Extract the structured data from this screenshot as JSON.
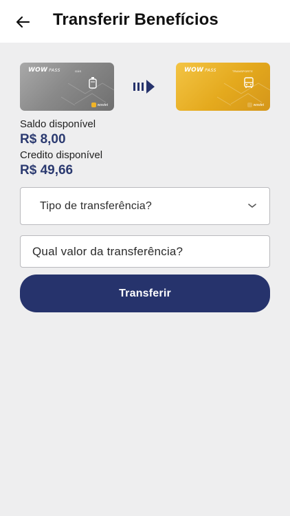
{
  "header": {
    "title": "Transferir Benefícios",
    "back_icon": "arrow-left-icon"
  },
  "cards": {
    "source": {
      "brand": "WOW",
      "brand_suffix": "PASS",
      "type": "GÁS",
      "footer": "wowlet",
      "icon": "gas-cylinder-icon"
    },
    "target": {
      "brand": "WOW",
      "brand_suffix": "PASS",
      "type": "TRANSPORTE",
      "footer": "wowlet",
      "icon": "bus-icon"
    },
    "transfer_arrow_icon": "transfer-arrow-icon"
  },
  "balances": {
    "saldo_label": "Saldo disponível",
    "saldo_value": "R$ 8,00",
    "credito_label": "Credito disponível",
    "credito_value": "R$ 49,66"
  },
  "form": {
    "transfer_type_placeholder": "Tipo de transferência?",
    "amount_placeholder": "Qual valor da transferência?",
    "submit_label": "Transferir"
  },
  "colors": {
    "primary": "#26336c",
    "value_text": "#2b3a70",
    "background": "#eeeeef",
    "card_gold": "#e4a91d",
    "card_gray": "#8a8a8a"
  }
}
